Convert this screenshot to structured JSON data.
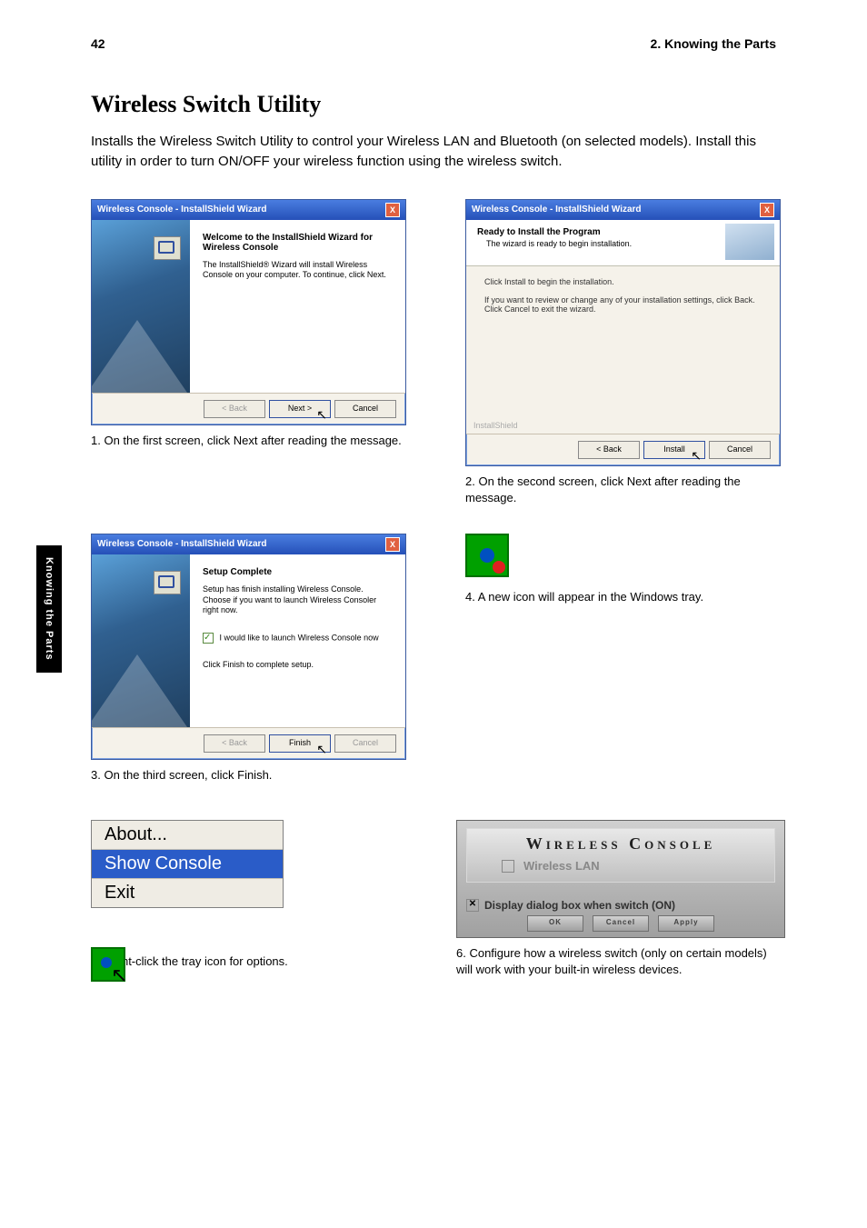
{
  "header": {
    "page_number": "42",
    "right": "2. Knowing the Parts"
  },
  "side_tab": "Knowing the Parts",
  "section": {
    "title": "Wireless Switch Utility",
    "intro": "Installs the Wireless Switch Utility to control your Wireless LAN and Bluetooth (on selected models). Install this utility in order to turn ON/OFF your wireless function using the wireless switch."
  },
  "wizard_title": "Wireless Console - InstallShield Wizard",
  "wiz1": {
    "heading": "Welcome to the InstallShield Wizard for Wireless Console",
    "body": "The InstallShield® Wizard will install Wireless Console on your computer. To continue, click Next.",
    "back": "< Back",
    "next": "Next >",
    "cancel": "Cancel"
  },
  "wiz2": {
    "heading": "Ready to Install the Program",
    "sub": "The wizard is ready to begin installation.",
    "line1": "Click Install to begin the installation.",
    "line2": "If you want to review or change any of your installation settings, click Back. Click Cancel to exit the wizard.",
    "islabel": "InstallShield",
    "back": "< Back",
    "install": "Install",
    "cancel": "Cancel"
  },
  "wiz3": {
    "heading": "Setup Complete",
    "line1": "Setup has finish installing Wireless Console.",
    "line2": "Choose if you want to launch Wireless Consoler right now.",
    "chk": "I would like to launch Wireless Console now",
    "line3": "Click Finish to complete setup.",
    "back": "< Back",
    "finish": "Finish",
    "cancel": "Cancel"
  },
  "captions": {
    "c1": "1. On the first screen, click Next after reading the message.",
    "c2": "2. On the second screen, click Next after reading the message.",
    "c3": "3. On the third screen, click Finish.",
    "c4": "4. A new icon will appear in the Windows tray.",
    "c5": "5. Right-click the tray icon for options.",
    "c6": "6. Configure how a wireless switch (only on certain models) will work with your built-in wireless devices."
  },
  "ctx": {
    "about": "About...",
    "show": "Show Console",
    "exit": "Exit"
  },
  "wc": {
    "title": "Wireless Console",
    "wlan": "Wireless LAN",
    "opt": "Display dialog box when switch (ON)",
    "ok": "OK",
    "cancel": "Cancel",
    "apply": "Apply"
  }
}
